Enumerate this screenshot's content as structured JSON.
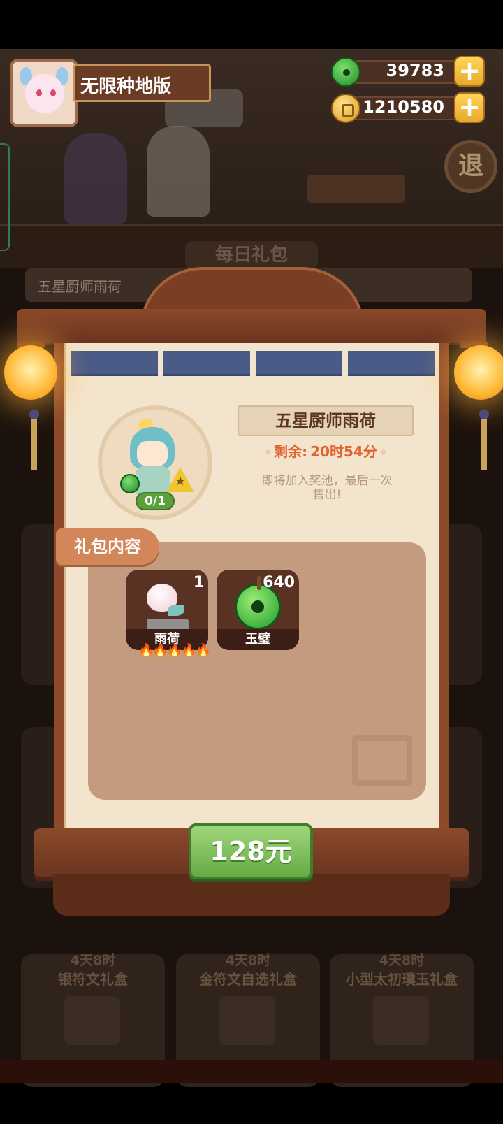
{
  "hud": {
    "player_name": "无限种地版",
    "jade": "39783",
    "coins": "1210580",
    "plus": "+"
  },
  "background": {
    "ribbon": "每日礼包",
    "row_title": "五星厨师雨荷",
    "exit": "退"
  },
  "gift": {
    "title": "五星厨师雨荷",
    "remaining_label": "剩余:",
    "remaining_value": "20时54分",
    "description": "即将加入奖池，最后一次售出!",
    "progress": "0/1",
    "content_tab": "礼包内容",
    "items": [
      {
        "name": "雨荷",
        "count": "1",
        "stars": 5
      },
      {
        "name": "玉璧",
        "count": "640"
      }
    ],
    "flames": "🔥🔥🔥🔥🔥",
    "price": "128元"
  },
  "shop_cards": [
    {
      "countdown": "4天8时",
      "name": "银符文礼盒"
    },
    {
      "countdown": "4天8时",
      "name": "金符文自选礼盒"
    },
    {
      "countdown": "4天8时",
      "name": "小型太初璞玉礼盒"
    }
  ],
  "colors": {
    "accent_green": "#64ac44",
    "timer_orange": "#e2622e",
    "wood": "#7a3e22"
  }
}
